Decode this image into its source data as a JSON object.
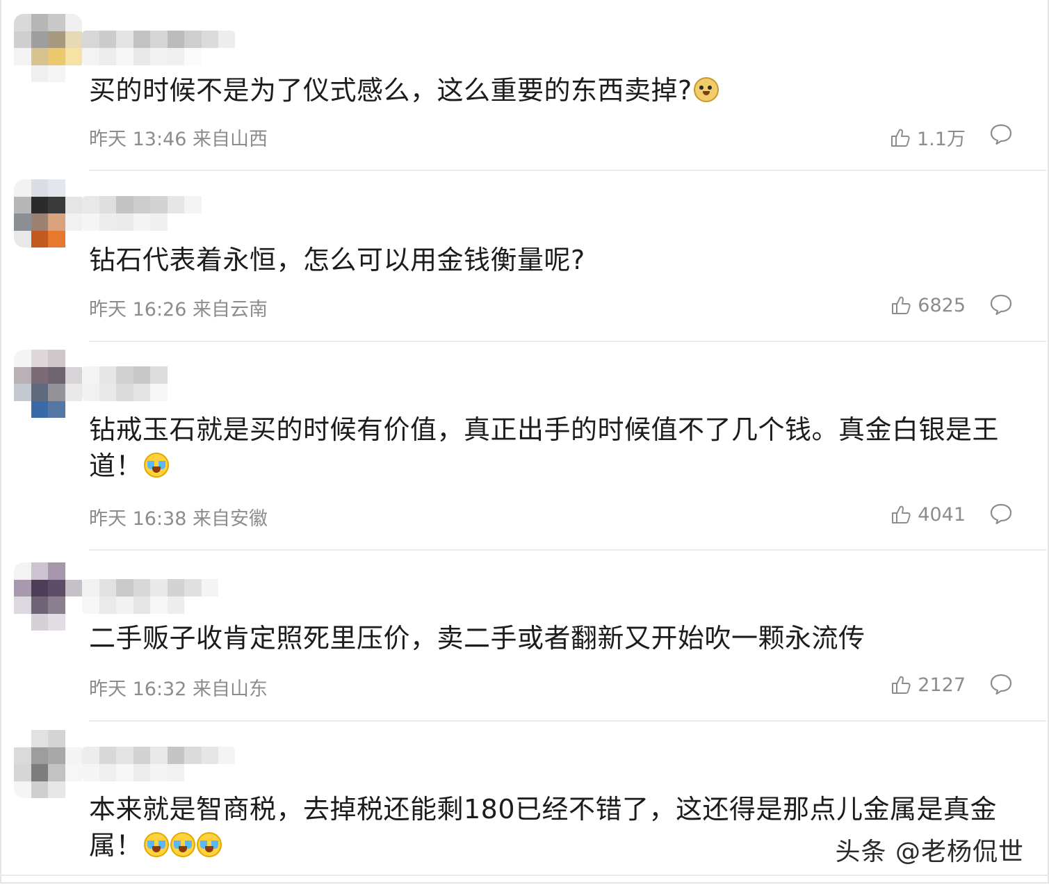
{
  "comments": [
    {
      "text": "买的时候不是为了仪式感么，这么重要的东西卖掉?",
      "emojis": [
        "doge-emoji"
      ],
      "time": "昨天 13:46 来自山西",
      "likes": "1.1万",
      "avatar_colors": [
        "#d9d9d9",
        "#b6b6b6",
        "#c8c8c8",
        "#f0f0f0",
        "#cfcfcf",
        "#9e9e9e",
        "#a89a7e",
        "#e8d9b5",
        "#f3f3f3",
        "#d6c38f",
        "#ecc86c",
        "#f7e2a4",
        "#ffffff",
        "#efefef",
        "#f5f5f5",
        "#ffffff"
      ],
      "nick_colors": [
        "#d3d3d3",
        "#c7c7c7",
        "#e0e0e0",
        "#bcbcbc",
        "#d1d1d1",
        "#b4b4b4",
        "#c9c9c9",
        "#d8d8d8",
        "#ececec",
        "#f2f2f2",
        "#ebebeb",
        "#f6f6f6",
        "#e7e7e7",
        "#f1f1f1",
        "#eeeeee",
        "#fafafa",
        "#ffffff",
        "#ffffff"
      ]
    },
    {
      "text": "钻石代表着永恒，怎么可以用金钱衡量呢?",
      "emojis": [],
      "time": "昨天 16:26 来自云南",
      "likes": "6825",
      "avatar_colors": [
        "#f2f2f2",
        "#d9dde4",
        "#e3e6ec",
        "#ffffff",
        "#b7b7b7",
        "#2b2b2b",
        "#3a3a3a",
        "#e5e5e5",
        "#8a8f96",
        "#9c8070",
        "#d9a37e",
        "#f1f1f1",
        "#e8e8e8",
        "#c25a1f",
        "#e6782f",
        "#ffffff"
      ],
      "nick_colors": [
        "#e6e6e6",
        "#dcdcdc",
        "#bdbdbd",
        "#c8c8c8",
        "#cfcfcf",
        "#e3e3e3",
        "#f3f3f3",
        "#ffffff",
        "#ffffff",
        "#f5f5f5",
        "#ececec",
        "#e9e9e9",
        "#f3f3f3",
        "#efefef",
        "#ffffff",
        "#ffffff",
        "#ffffff",
        "#ffffff"
      ]
    },
    {
      "text": "钻戒玉石就是买的时候有价值，真正出手的时候值不了几个钱。真金白银是王道！",
      "emojis": [
        "laugh-cry-emoji"
      ],
      "time": "昨天 16:38 来自安徽",
      "likes": "4041",
      "avatar_colors": [
        "#f4f4f4",
        "#ddd7da",
        "#d0c6cc",
        "#ffffff",
        "#b9b1b6",
        "#7c6b74",
        "#6f6570",
        "#d8d3d6",
        "#c4c8d0",
        "#5f6a7f",
        "#96929a",
        "#e9e9e9",
        "#ffffff",
        "#3a6aa8",
        "#5577a3",
        "#ffffff"
      ],
      "nick_colors": [
        "#f2f2f2",
        "#e4e4e4",
        "#cdcdcd",
        "#c2c2c2",
        "#dadada",
        "#ffffff",
        "#ffffff",
        "#ffffff",
        "#ffffff",
        "#f0f0f0",
        "#e6e6e6",
        "#d8d8d8",
        "#e0e0e0",
        "#f7f7f7",
        "#ffffff",
        "#ffffff",
        "#ffffff",
        "#ffffff"
      ]
    },
    {
      "text": "二手贩子收肯定照死里压价，卖二手或者翻新又开始吹一颗永流传",
      "emojis": [],
      "time": "昨天 16:32 来自山东",
      "likes": "2127",
      "avatar_colors": [
        "#f3f3f3",
        "#cbc3cf",
        "#a596ab",
        "#ffffff",
        "#a999ae",
        "#4d3d58",
        "#5d4d68",
        "#c6c0c8",
        "#ddd8df",
        "#6f6376",
        "#8a7f8f",
        "#ffffff",
        "#ffffff",
        "#d6d0d8",
        "#e2dde4",
        "#ffffff"
      ],
      "nick_colors": [
        "#f0f0f0",
        "#dedede",
        "#c4c4c4",
        "#d4d4d4",
        "#e7e7e7",
        "#cfcfcf",
        "#dddddd",
        "#f3f3f3",
        "#ffffff",
        "#f6f6f6",
        "#e8e8e8",
        "#f1f1f1",
        "#e4e4e4",
        "#f7f7f7",
        "#ececec",
        "#ffffff",
        "#ffffff",
        "#ffffff"
      ]
    },
    {
      "text": "本来就是智商税，去掉税还能剩180已经不错了，这还得是那点儿金属是真金属！",
      "emojis": [
        "laugh-cry-emoji",
        "laugh-cry-emoji",
        "laugh-cry-emoji"
      ],
      "time": "",
      "likes": "",
      "avatar_colors": [
        "#ffffff",
        "#e1e1e1",
        "#d4d4d4",
        "#ffffff",
        "#dadada",
        "#9d9d9d",
        "#a8a8a8",
        "#f4f4f4",
        "#d6d6d6",
        "#7d7d7d",
        "#c2c2c2",
        "#f6f6f6",
        "#f5f5f5",
        "#cfcfcf",
        "#e7e7e7",
        "#ffffff"
      ],
      "nick_colors": [
        "#ececec",
        "#d4d4d4",
        "#e0e0e0",
        "#cfcfcf",
        "#e6e6e6",
        "#bfbfbf",
        "#d8d8d8",
        "#e4e4e4",
        "#f3f3f3",
        "#f5f5f5",
        "#eeeeee",
        "#f7f7f7",
        "#ebebeb",
        "#f3f3f3",
        "#f0f0f0",
        "#ffffff",
        "#ffffff",
        "#ffffff"
      ]
    }
  ],
  "watermark": "头条 @老杨侃世",
  "colors": {
    "text": "#1c1c1c",
    "meta": "#8c8c8c",
    "divider": "#e9e9e9"
  },
  "icons": {
    "like": "thumbs-up-icon",
    "reply": "comment-bubble-icon"
  }
}
